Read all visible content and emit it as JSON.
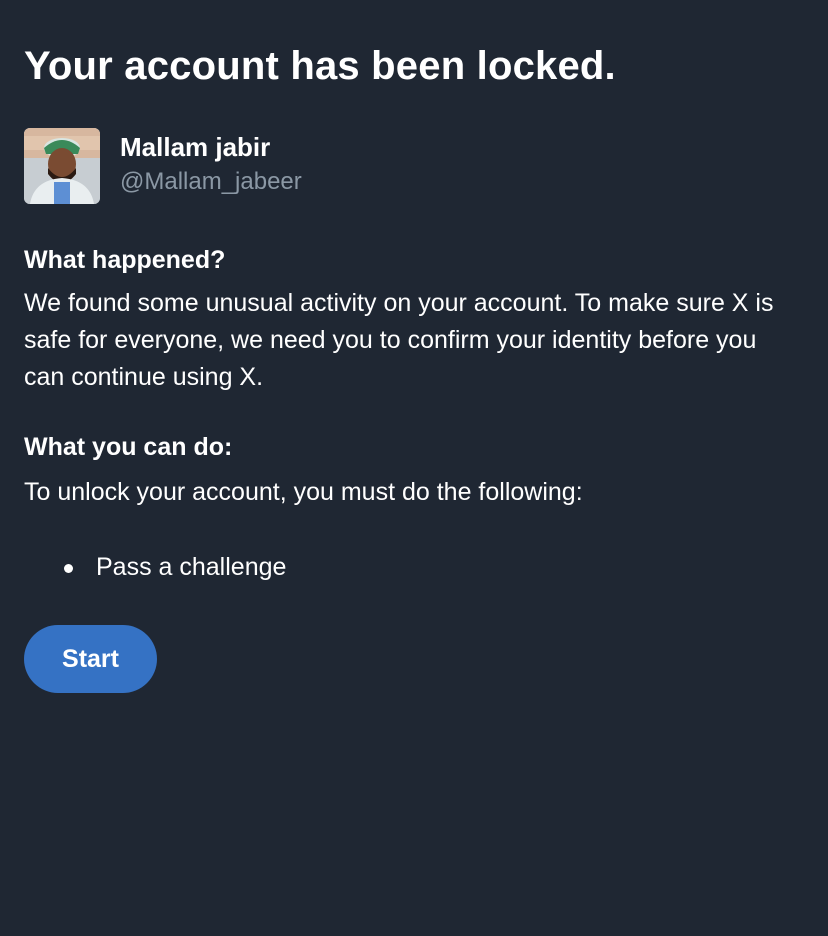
{
  "title": "Your account has been locked.",
  "profile": {
    "display_name": "Mallam jabir",
    "handle": "@Mallam_jabeer"
  },
  "what_happened": {
    "heading": "What happened?",
    "text": "We found some unusual activity on your account. To make sure X is safe for everyone, we need you to confirm your identity before you can continue using X."
  },
  "what_you_can_do": {
    "heading": "What you can do:",
    "text": "To unlock your account, you must do the following:",
    "steps": [
      "Pass a challenge"
    ]
  },
  "start_button": {
    "label": "Start"
  },
  "colors": {
    "background": "#1f2733",
    "text": "#ffffff",
    "secondary_text": "#8b98a5",
    "button": "#3572c4"
  }
}
